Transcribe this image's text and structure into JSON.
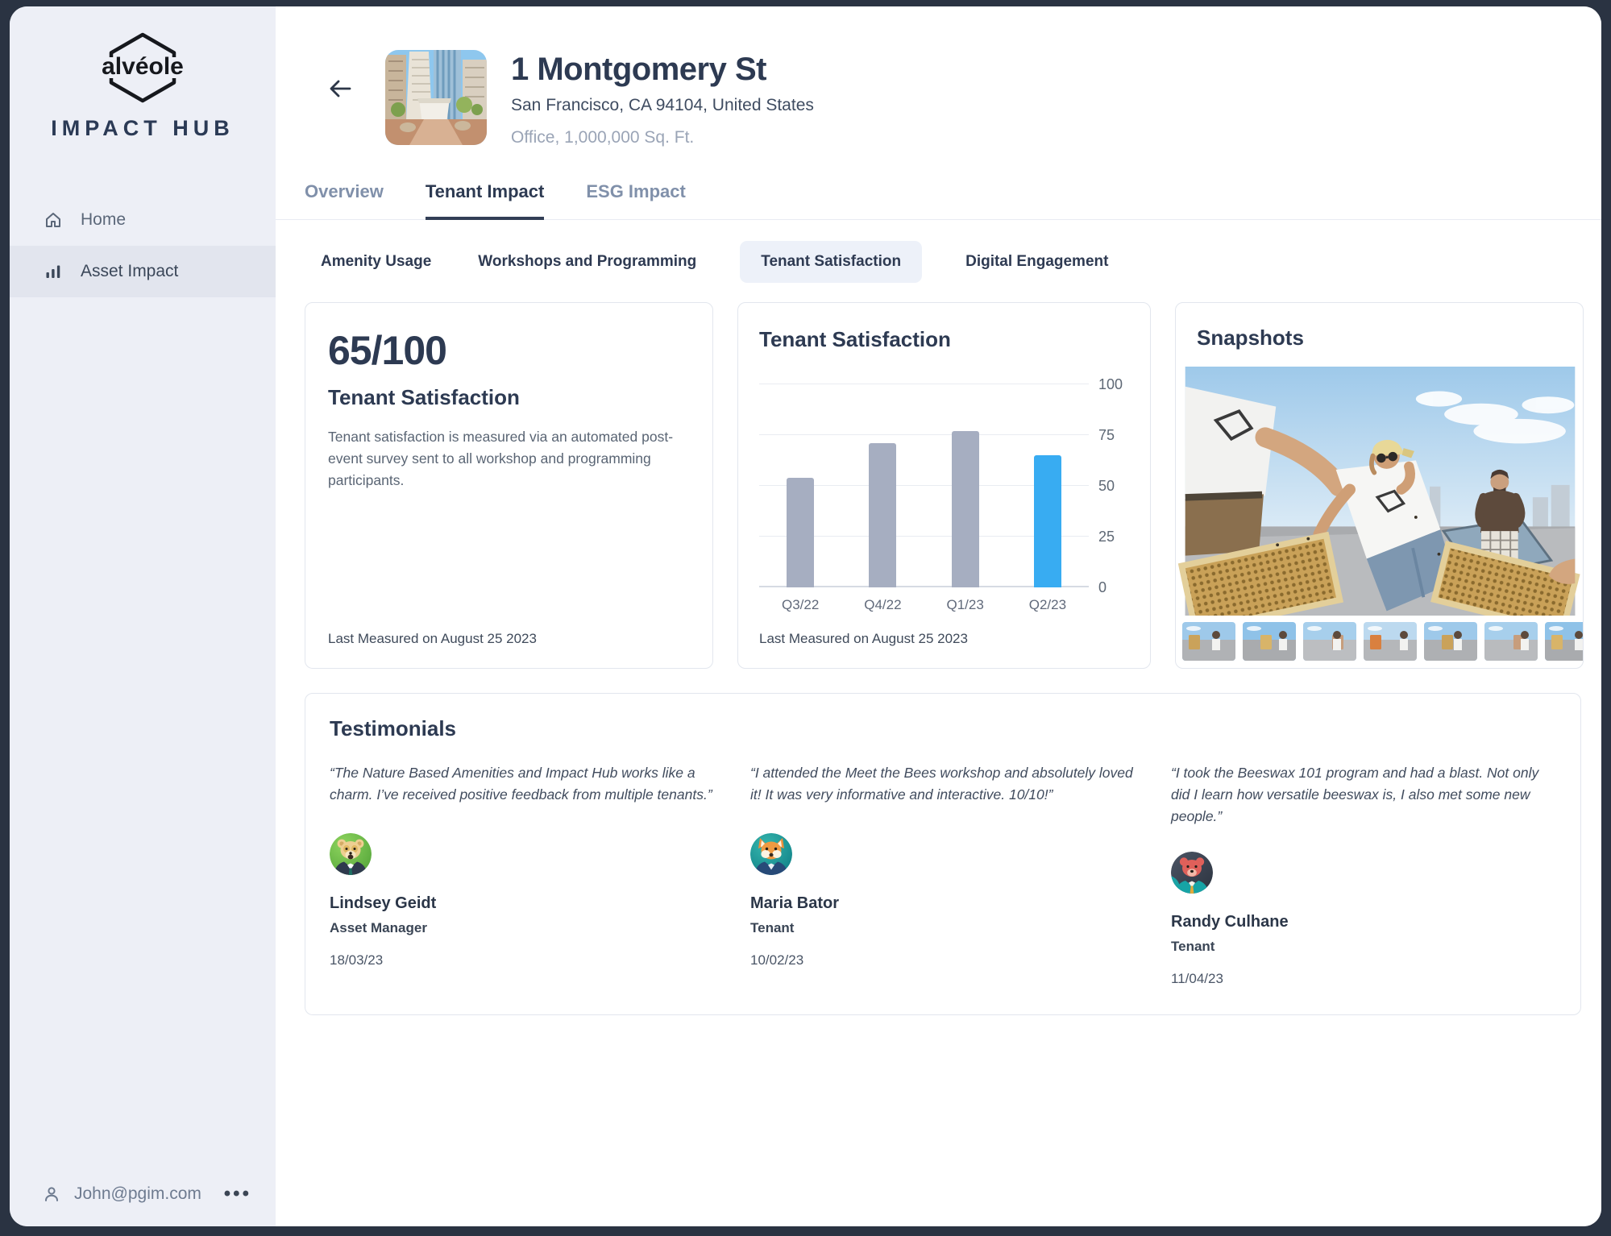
{
  "window": {
    "frame_color": "#2a3342"
  },
  "sidebar": {
    "logo_text": "alvéole",
    "brand": "IMPACT HUB",
    "items": [
      {
        "label": "Home",
        "icon": "home-icon",
        "active": false
      },
      {
        "label": "Asset Impact",
        "icon": "bar-chart-icon",
        "active": true
      }
    ],
    "footer": {
      "email": "John@pgim.com",
      "user_icon": "person-icon",
      "more_icon": "more-horizontal-icon"
    }
  },
  "header": {
    "back_icon": "arrow-left-icon",
    "title": "1 Montgomery St",
    "address": "San Francisco, CA 94104, United States",
    "meta": "Office, 1,000,000 Sq. Ft."
  },
  "tabs": [
    {
      "label": "Overview",
      "active": false
    },
    {
      "label": "Tenant Impact",
      "active": true
    },
    {
      "label": "ESG Impact",
      "active": false
    }
  ],
  "subtabs": [
    {
      "label": "Amenity Usage",
      "active": false
    },
    {
      "label": "Workshops and Programming",
      "active": false
    },
    {
      "label": "Tenant Satisfaction",
      "active": true
    },
    {
      "label": "Digital Engagement",
      "active": false
    }
  ],
  "score_card": {
    "score": "65/100",
    "title": "Tenant Satisfaction",
    "description": "Tenant satisfaction is measured via an automated post-event survey sent to all workshop and programming participants.",
    "footnote": "Last Measured on August 25 2023"
  },
  "chart_card": {
    "title": "Tenant Satisfaction",
    "footnote": "Last Measured on August 25 2023"
  },
  "chart_data": {
    "type": "bar",
    "title": "Tenant Satisfaction",
    "categories": [
      "Q3/22",
      "Q4/22",
      "Q1/23",
      "Q2/23"
    ],
    "values": [
      54,
      71,
      77,
      65
    ],
    "ylim": [
      0,
      100
    ],
    "yticks": [
      0,
      25,
      50,
      75,
      100
    ],
    "y_axis_side": "right",
    "grid": true,
    "bar_color": "#a6aec1",
    "highlight_color": "#38acf2",
    "highlight_index": 3
  },
  "snapshots": {
    "title": "Snapshots",
    "thumbnail_count": 7
  },
  "testimonials": {
    "title": "Testimonials",
    "items": [
      {
        "quote": "“The Nature Based Amenities and Impact Hub works like a charm. I’ve received positive feedback from multiple tenants.”",
        "name": "Lindsey Geidt",
        "role": "Asset Manager",
        "date": "18/03/23",
        "avatar": "bear-suit-green-avatar"
      },
      {
        "quote": "“I attended the Meet the Bees workshop and absolutely loved it! It was very informative and interactive. 10/10!”",
        "name": "Maria Bator",
        "role": "Tenant",
        "date": "10/02/23",
        "avatar": "fox-teal-avatar"
      },
      {
        "quote": "“I took the Beeswax 101 program and had a blast. Not only did I learn how versatile beeswax is, I also met some new people.”",
        "name": "Randy Culhane",
        "role": "Tenant",
        "date": "11/04/23",
        "avatar": "bear-red-dark-avatar"
      }
    ]
  }
}
